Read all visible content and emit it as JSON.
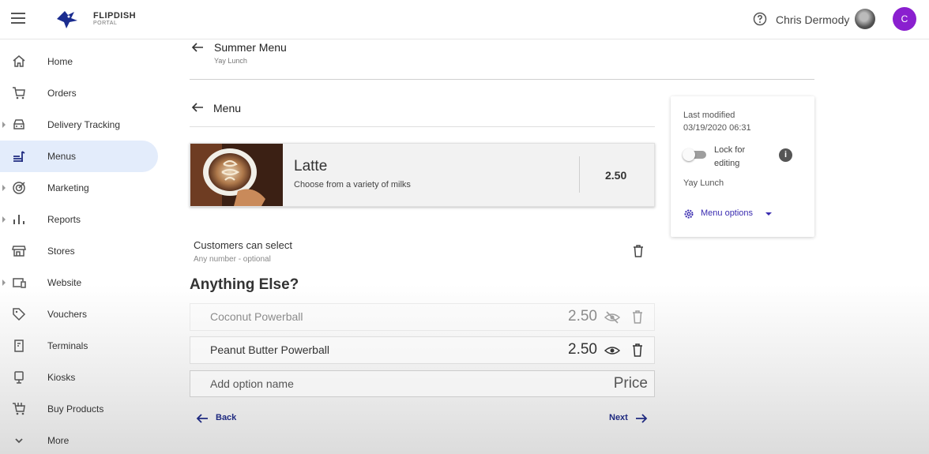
{
  "header": {
    "brand_name": "FLIPDISH",
    "brand_sub": "PORTAL",
    "user_name": "Chris Dermody",
    "avatar_letter": "C",
    "avatar_color": "#8a1fcf"
  },
  "sidebar": {
    "items": [
      {
        "label": "Home",
        "icon": "home-icon"
      },
      {
        "label": "Orders",
        "icon": "cart-icon"
      },
      {
        "label": "Delivery Tracking",
        "icon": "car-icon"
      },
      {
        "label": "Menus",
        "icon": "menu-book-icon",
        "active": true
      },
      {
        "label": "Marketing",
        "icon": "target-icon"
      },
      {
        "label": "Reports",
        "icon": "bar-chart-icon"
      },
      {
        "label": "Stores",
        "icon": "store-icon"
      },
      {
        "label": "Website",
        "icon": "devices-icon"
      },
      {
        "label": "Vouchers",
        "icon": "tag-icon"
      },
      {
        "label": "Terminals",
        "icon": "terminal-icon"
      },
      {
        "label": "Kiosks",
        "icon": "kiosk-icon"
      },
      {
        "label": "Buy Products",
        "icon": "shopping-cart-icon"
      },
      {
        "label": "More",
        "icon": "chevron-down-icon"
      }
    ]
  },
  "breadcrumb": {
    "title": "Summer Menu",
    "subtitle": "Yay Lunch"
  },
  "section": {
    "title": "Menu"
  },
  "item": {
    "name": "Latte",
    "description": "Choose from a variety of milks",
    "price": "2.50"
  },
  "options_group": {
    "rule_title": "Customers can select",
    "rule_sub": "Any number - optional",
    "name": "Anything Else?",
    "options": [
      {
        "name": "Coconut Powerball",
        "price": "2.50",
        "visible": false
      },
      {
        "name": "Peanut Butter Powerball",
        "price": "2.50",
        "visible": true
      }
    ],
    "add_placeholder": "Add option name",
    "price_placeholder": "Price"
  },
  "nav_buttons": {
    "back": "Back",
    "next": "Next"
  },
  "panel": {
    "last_modified_label": "Last modified",
    "last_modified_date": "03/19/2020 06:31",
    "lock_label": "Lock for editing",
    "lock_enabled": false,
    "menu_name": "Yay Lunch",
    "menu_options_label": "Menu options"
  },
  "colors": {
    "accent": "#3a2cb0",
    "nav_active_bg": "#e3ecfb",
    "link": "#1f2a80"
  }
}
